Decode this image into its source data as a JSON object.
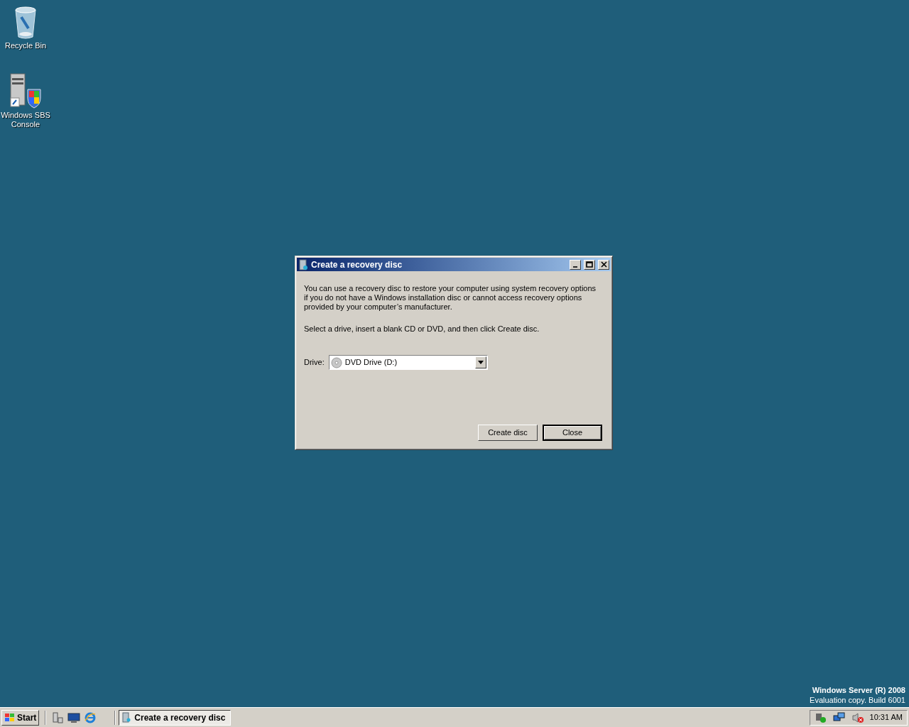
{
  "desktop_icons": [
    {
      "label": "Recycle Bin",
      "kind": "bin"
    },
    {
      "label": "Windows SBS Console",
      "kind": "server"
    }
  ],
  "window": {
    "title": "Create a recovery disc",
    "paragraphs": [
      "You can use a recovery disc to restore your computer using system recovery options if you do not have a Windows installation disc or cannot access recovery options provided by your computer’s manufacturer.",
      "Select a drive, insert a blank CD or DVD, and then click Create disc."
    ],
    "drive": {
      "label": "Drive:",
      "value": "DVD Drive (D:)"
    },
    "buttons": [
      {
        "label": "Create disc",
        "default": false
      },
      {
        "label": "Close",
        "default": true
      }
    ]
  },
  "desktop_version": {
    "title": "Windows Server (R) 2008",
    "subtitle": "Evaluation copy. Build 6001"
  },
  "taskbar": {
    "start": "Start",
    "tasks": [
      {
        "label": "Create a recovery disc",
        "selected": true
      }
    ],
    "clock": "10:31 AM"
  }
}
